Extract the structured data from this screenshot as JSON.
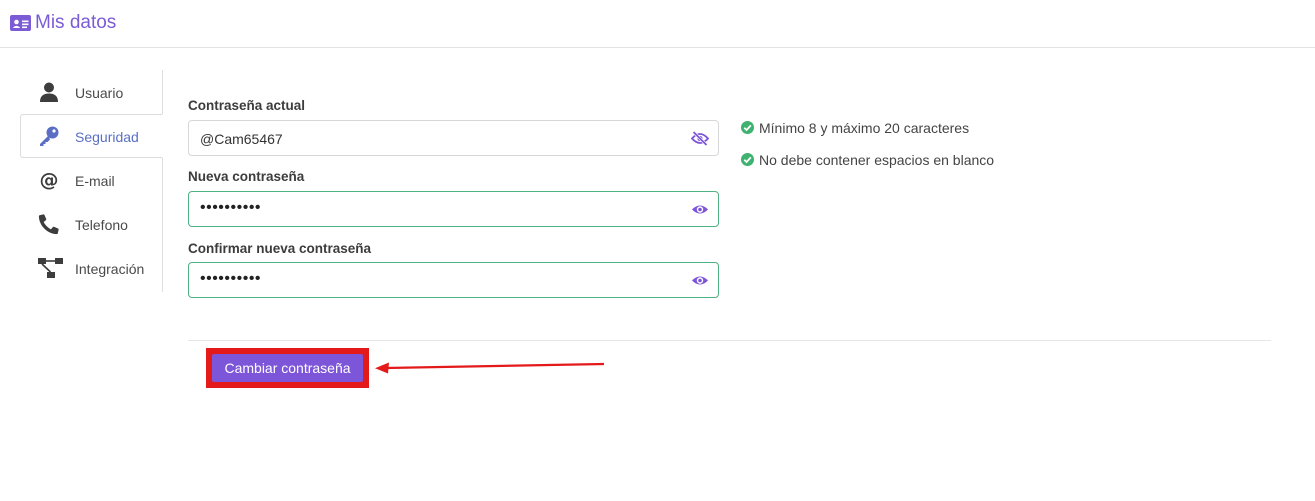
{
  "header": {
    "title": "Mis datos",
    "icon": "id-card-icon",
    "color": "#7b5cd6"
  },
  "sidebar": {
    "items": [
      {
        "label": "Usuario",
        "icon": "user-icon",
        "active": false
      },
      {
        "label": "Seguridad",
        "icon": "key-icon",
        "active": true
      },
      {
        "label": "E-mail",
        "icon": "at-icon",
        "active": false
      },
      {
        "label": "Telefono",
        "icon": "phone-icon",
        "active": false
      },
      {
        "label": "Integración",
        "icon": "sitemap-icon",
        "active": false
      }
    ]
  },
  "form": {
    "current_password": {
      "label": "Contraseña actual",
      "value": "@Cam65467",
      "icon": "eye-slash-icon"
    },
    "new_password": {
      "label": "Nueva contraseña",
      "value": "••••••••••",
      "icon": "eye-icon"
    },
    "confirm_password": {
      "label": "Confirmar nueva contraseña",
      "value": "••••••••••",
      "icon": "eye-icon"
    },
    "submit_label": "Cambiar contraseña"
  },
  "rules": [
    {
      "text": "Mínimo 8 y máximo 20 caracteres",
      "ok": true
    },
    {
      "text": "No debe contener espacios en blanco",
      "ok": true
    }
  ],
  "colors": {
    "accent": "#7d55d9",
    "valid_border": "#4fb283",
    "check_green": "#3fb26f",
    "annotation_red": "#e41a1a"
  }
}
